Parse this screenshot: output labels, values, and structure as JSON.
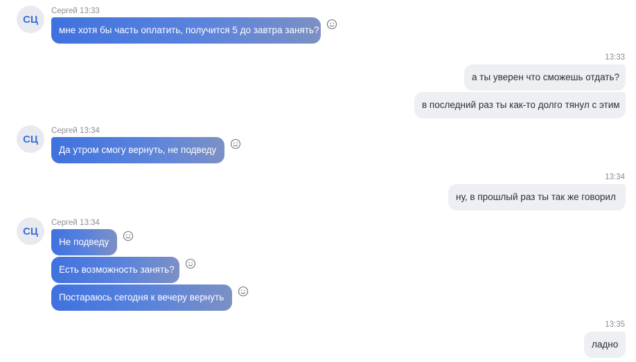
{
  "avatar_initials": "СЦ",
  "groups": [
    {
      "meta": "Сергей 13:33",
      "messages": [
        "мне хотя бы часть оплатить, получится 5 до завтра занять?"
      ]
    },
    {
      "time": "13:33",
      "messages": [
        "а ты уверен что сможешь отдать?",
        "в последний раз ты как-то долго тянул с этим"
      ]
    },
    {
      "meta": "Сергей 13:34",
      "messages": [
        "Да утром смогу вернуть, не подведу"
      ]
    },
    {
      "time": "13:34",
      "messages": [
        "ну, в прошлый раз ты так же говорил"
      ]
    },
    {
      "meta": "Сергей 13:34",
      "messages": [
        "Не подведу",
        "Есть возможность занять?",
        "Постараюсь сегодня к вечеру вернуть"
      ]
    },
    {
      "time": "13:35",
      "messages": [
        "ладно"
      ]
    }
  ],
  "colors": {
    "incoming_start": "#3f72df",
    "incoming_end": "#7c90c4",
    "outgoing_bg": "#eeeff3",
    "avatar_text": "#3c6fd6"
  },
  "icons": {
    "reaction": "smile-icon"
  }
}
